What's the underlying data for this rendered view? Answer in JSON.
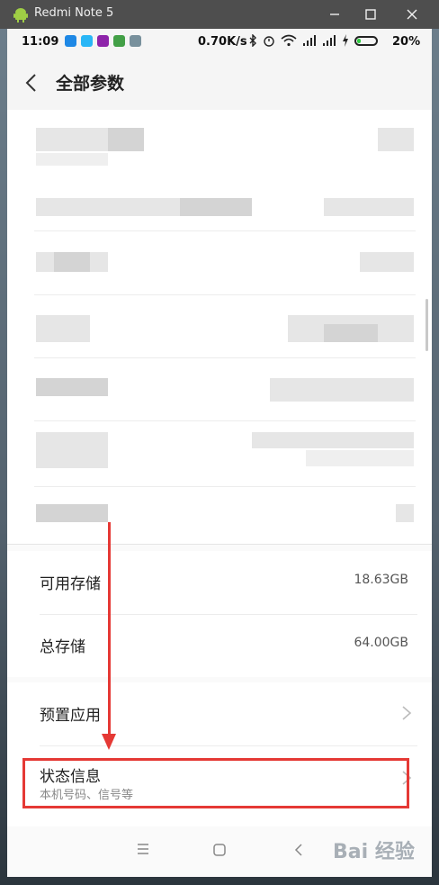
{
  "window": {
    "title": "Redmi Note 5",
    "buttons": {
      "minimize": "—",
      "maximize": "☐",
      "close": "✕"
    }
  },
  "status_bar": {
    "time": "11:09",
    "net_speed": "0.70K/s",
    "battery_percent": "20%",
    "battery_level": 0.2,
    "accent_green": "#2ecc40"
  },
  "header": {
    "title": "全部参数"
  },
  "storage": {
    "available_label": "可用存储",
    "available_value": "18.63GB",
    "total_label": "总存储",
    "total_value": "64.00GB"
  },
  "menu": {
    "preinstalled_label": "预置应用",
    "status_label": "状态信息",
    "status_sub": "本机号码、信号等"
  },
  "nav": {
    "menu_glyph": "☰",
    "home_glyph": "○",
    "back_glyph": "‹"
  },
  "annotation": {
    "color": "#e53935"
  },
  "watermark": {
    "text": "Bai 经验"
  }
}
